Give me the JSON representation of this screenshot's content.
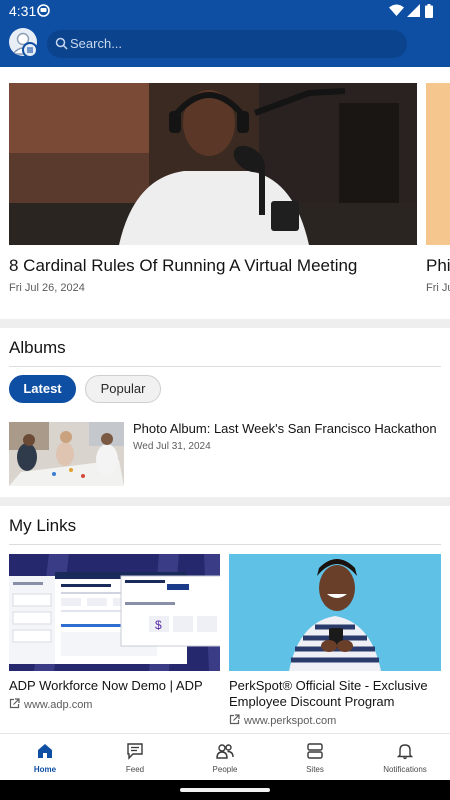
{
  "status_bar": {
    "time": "4:31"
  },
  "header": {
    "search_placeholder": "Search..."
  },
  "news": [
    {
      "title": "8 Cardinal Rules Of Running A Virtual Meeting",
      "date": "Fri Jul 26, 2024"
    },
    {
      "title": "Phi",
      "date": "Fri Ju"
    }
  ],
  "albums": {
    "title": "Albums",
    "tabs": [
      {
        "label": "Latest",
        "selected": true
      },
      {
        "label": "Popular",
        "selected": false
      }
    ],
    "items": [
      {
        "title": "Photo Album: Last Week's San Francisco Hackathon",
        "date": "Wed Jul 31, 2024"
      }
    ]
  },
  "my_links": {
    "title": "My Links",
    "items": [
      {
        "title_line1": "ADP Workforce Now Demo | ADP",
        "title_line2": "",
        "url": "www.adp.com"
      },
      {
        "title_line1": "PerkSpot® Official Site - Exclusive",
        "title_line2": "Employee Discount Program",
        "url": "www.perkspot.com"
      }
    ]
  },
  "bottom_nav": [
    {
      "label": "Home",
      "icon": "home-icon",
      "active": true
    },
    {
      "label": "Feed",
      "icon": "feed-icon",
      "active": false
    },
    {
      "label": "People",
      "icon": "people-icon",
      "active": false
    },
    {
      "label": "Sites",
      "icon": "sites-icon",
      "active": false
    },
    {
      "label": "Notifications",
      "icon": "bell-icon",
      "active": false
    }
  ],
  "colors": {
    "brand": "#0f4fa3",
    "search_bg": "#0b438d",
    "section_gap": "#eeeeee"
  }
}
